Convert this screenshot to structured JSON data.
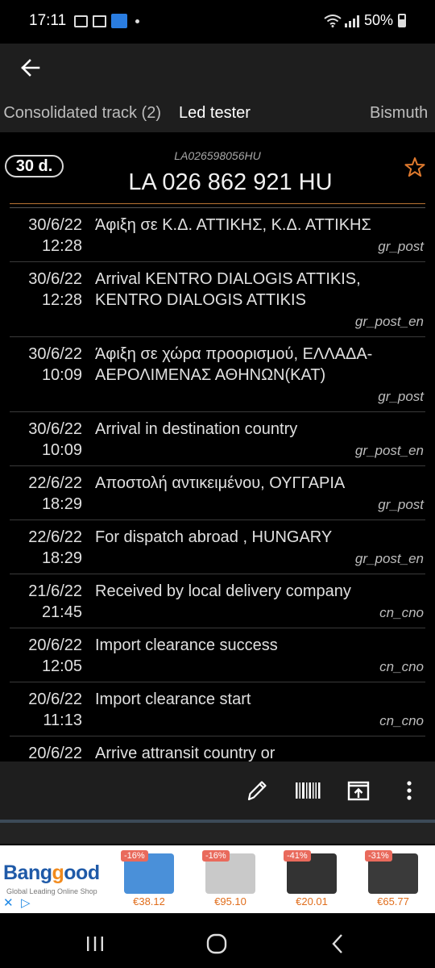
{
  "status": {
    "time": "17:11",
    "battery": "50%"
  },
  "tabs": [
    {
      "label": "Consolidated track (2)"
    },
    {
      "label": "Led tester"
    },
    {
      "label": "Bismuth"
    }
  ],
  "parcel": {
    "days": "30 d.",
    "code_small": "LA026598056HU",
    "code_big": "LA 026 862 921 HU"
  },
  "events": [
    {
      "date": "30/6/22",
      "time": "12:28",
      "text": "Άφιξη σε Κ.Δ. ΑΤΤΙΚΗΣ, Κ.Δ. ΑΤΤΙΚΗΣ",
      "source": "gr_post"
    },
    {
      "date": "30/6/22",
      "time": "12:28",
      "text": "Arrival KENTRO DIALOGIS ATTIKIS, KENTRO DIALOGIS ATTIKIS",
      "source": "gr_post_en"
    },
    {
      "date": "30/6/22",
      "time": "10:09",
      "text": "Άφιξη σε χώρα προορισμού, ΕΛΛΑΔΑ-ΑΕΡΟΛΙΜΕΝΑΣ ΑΘΗΝΩΝ(ΚΑΤ)",
      "source": "gr_post"
    },
    {
      "date": "30/6/22",
      "time": "10:09",
      "text": "Arrival in destination country",
      "source": "gr_post_en"
    },
    {
      "date": "22/6/22",
      "time": "18:29",
      "text": "Αποστολή αντικειμένου, ΟΥΓΓΑΡΙΑ",
      "source": "gr_post"
    },
    {
      "date": "22/6/22",
      "time": "18:29",
      "text": "For dispatch abroad , HUNGARY",
      "source": "gr_post_en"
    },
    {
      "date": "21/6/22",
      "time": "21:45",
      "text": "Received by local delivery company",
      "source": "cn_cno"
    },
    {
      "date": "20/6/22",
      "time": "12:05",
      "text": "Import clearance success",
      "source": "cn_cno"
    },
    {
      "date": "20/6/22",
      "time": "11:13",
      "text": "Import clearance start",
      "source": "cn_cno"
    },
    {
      "date": "20/6/22",
      "time": "",
      "text": "Arrive attransit country or",
      "source": ""
    }
  ],
  "ad": {
    "brand_part1": "Bang",
    "brand_part2": "g",
    "brand_part3": "ood",
    "tagline": "Global Leading Online Shop",
    "products": [
      {
        "discount": "-16%",
        "price": "€38.12",
        "color": "#4a90d9"
      },
      {
        "discount": "-16%",
        "price": "€95.10",
        "color": "#c9c9c9"
      },
      {
        "discount": "-41%",
        "price": "€20.01",
        "color": "#333333"
      },
      {
        "discount": "-31%",
        "price": "€65.77",
        "color": "#3a3a3a"
      }
    ]
  },
  "colors": {
    "accent": "#e07a2e",
    "separator": "#b87333"
  }
}
